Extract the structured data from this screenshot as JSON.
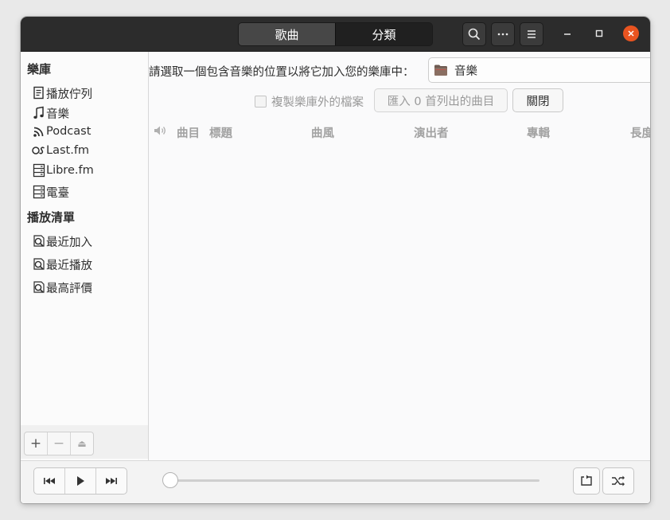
{
  "header": {
    "tabs": [
      {
        "label": "歌曲",
        "active": true
      },
      {
        "label": "分類",
        "active": false
      }
    ],
    "buttons": [
      "search-icon",
      "more-icon",
      "menu-icon"
    ],
    "window_controls": [
      "minimize",
      "maximize",
      "close"
    ]
  },
  "sidebar": {
    "library_heading": "樂庫",
    "library_items": [
      {
        "label": "播放佇列",
        "icon": "queue-icon"
      },
      {
        "label": "音樂",
        "icon": "music-note-icon"
      },
      {
        "label": "Podcast",
        "icon": "podcast-icon"
      },
      {
        "label": "Last.fm",
        "icon": "lastfm-icon"
      },
      {
        "label": "Libre.fm",
        "icon": "librefm-icon"
      },
      {
        "label": "電臺",
        "icon": "radio-icon"
      }
    ],
    "playlists_heading": "播放清單",
    "playlist_items": [
      {
        "label": "最近加入",
        "icon": "smart-playlist-icon"
      },
      {
        "label": "最近播放",
        "icon": "smart-playlist-icon"
      },
      {
        "label": "最高評價",
        "icon": "smart-playlist-icon"
      }
    ],
    "toolbar": {
      "add": "+",
      "remove": "−",
      "eject": "⏏"
    }
  },
  "main": {
    "prompt": "請選取一個包含音樂的位置以將它加入您的樂庫中：",
    "folder_chooser": {
      "label": "音樂",
      "icon": "folder-icon"
    },
    "copy_files_checkbox": {
      "label": "複製樂庫外的檔案",
      "checked": false
    },
    "import_button": "匯入 0 首列出的曲目",
    "close_button": "關閉",
    "columns": [
      "曲目",
      "標題",
      "曲風",
      "演出者",
      "專輯",
      "長度"
    ]
  },
  "player": {
    "controls": [
      "previous-icon",
      "play-icon",
      "next-icon"
    ],
    "progress": 0,
    "toggles": [
      "repeat-icon",
      "shuffle-icon"
    ]
  },
  "colors": {
    "headerbar": "#2c2c2c",
    "accent_close": "#e95420",
    "sidebar_bg": "#fbfbfb",
    "content_bg": "#fafafb"
  }
}
